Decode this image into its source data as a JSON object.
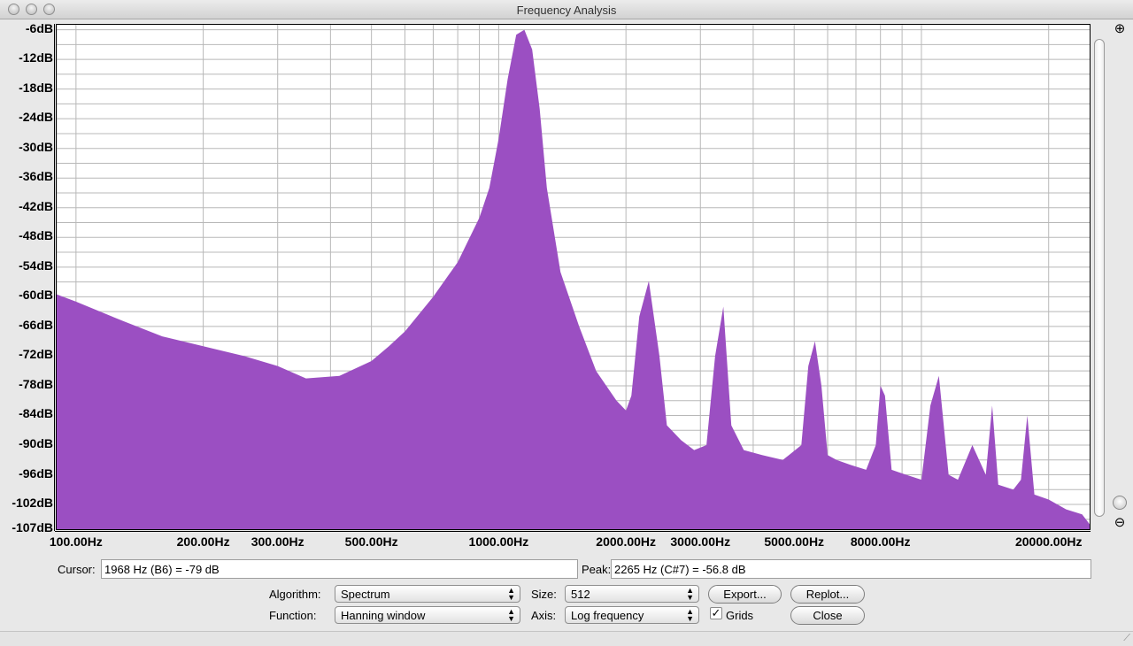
{
  "window": {
    "title": "Frequency Analysis"
  },
  "chart_data": {
    "type": "area",
    "color": "#9b4fc2",
    "x_scale": "log",
    "xlim": [
      90,
      25000
    ],
    "ylim": [
      -107,
      -5
    ],
    "grid": true,
    "y_ticks": [
      "-6dB",
      "-12dB",
      "-18dB",
      "-24dB",
      "-30dB",
      "-36dB",
      "-42dB",
      "-48dB",
      "-54dB",
      "-60dB",
      "-66dB",
      "-72dB",
      "-78dB",
      "-84dB",
      "-90dB",
      "-96dB",
      "-102dB",
      "-107dB"
    ],
    "y_tick_values": [
      -6,
      -12,
      -18,
      -24,
      -30,
      -36,
      -42,
      -48,
      -54,
      -60,
      -66,
      -72,
      -78,
      -84,
      -90,
      -96,
      -102,
      -107
    ],
    "x_ticks": [
      "100.00Hz",
      "200.00Hz",
      "300.00Hz",
      "500.00Hz",
      "1000.00Hz",
      "2000.00Hz",
      "3000.00Hz",
      "5000.00Hz",
      "8000.00Hz",
      "20000.00Hz"
    ],
    "x_tick_values": [
      100,
      200,
      300,
      500,
      1000,
      2000,
      3000,
      5000,
      8000,
      20000
    ],
    "x": [
      90,
      100,
      130,
      160,
      200,
      250,
      300,
      350,
      420,
      500,
      550,
      600,
      700,
      800,
      900,
      950,
      1000,
      1050,
      1100,
      1150,
      1200,
      1250,
      1300,
      1400,
      1550,
      1700,
      1900,
      2000,
      2060,
      2150,
      2265,
      2400,
      2500,
      2700,
      2900,
      3100,
      3250,
      3400,
      3550,
      3800,
      4200,
      4700,
      5200,
      5400,
      5600,
      5800,
      6000,
      6300,
      6800,
      7400,
      7800,
      8000,
      8200,
      8500,
      9200,
      10000,
      10500,
      11000,
      11600,
      12200,
      13200,
      14200,
      14700,
      15200,
      16500,
      17200,
      17800,
      18500,
      20000,
      22000,
      24000,
      25000
    ],
    "y": [
      -59.5,
      -61,
      -65,
      -68,
      -70,
      -72,
      -74,
      -76.5,
      -76,
      -73,
      -70,
      -67,
      -60,
      -53,
      -44,
      -38,
      -28,
      -16,
      -7,
      -6,
      -10,
      -22,
      -38,
      -55,
      -66,
      -75,
      -81,
      -83,
      -80,
      -64,
      -56.8,
      -72,
      -86,
      -89,
      -91,
      -90,
      -72,
      -62,
      -86,
      -91,
      -92,
      -93,
      -90,
      -74,
      -69,
      -78,
      -92,
      -93,
      -94,
      -95,
      -90,
      -78,
      -80,
      -95,
      -96,
      -97,
      -82,
      -76,
      -96,
      -97,
      -90,
      -96,
      -82,
      -98,
      -99,
      -97,
      -84,
      -100,
      -101,
      -103,
      -104,
      -106
    ],
    "annotations": []
  },
  "cursor": {
    "label": "Cursor:",
    "value": "1968 Hz (B6) = -79 dB"
  },
  "peak": {
    "label": "Peak:",
    "value": "2265 Hz (C#7) = -56.8 dB"
  },
  "controls": {
    "algorithm_label": "Algorithm:",
    "algorithm_value": "Spectrum",
    "function_label": "Function:",
    "function_value": "Hanning window",
    "size_label": "Size:",
    "size_value": "512",
    "axis_label": "Axis:",
    "axis_value": "Log frequency",
    "grids_label": "Grids",
    "grids_checked": true,
    "export_label": "Export...",
    "replot_label": "Replot...",
    "close_label": "Close"
  },
  "icons": {
    "zoom_in": "zoom-in-icon",
    "zoom_out": "zoom-out-icon",
    "resize_grip": "resize-grip-icon"
  }
}
